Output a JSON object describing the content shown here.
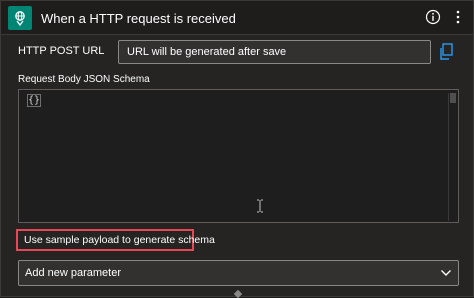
{
  "header": {
    "title": "When a HTTP request is received",
    "icon": "http-request-icon",
    "accent": "#008575"
  },
  "url": {
    "label": "HTTP POST URL",
    "value": "URL will be generated after save"
  },
  "schema": {
    "label": "Request Body JSON Schema",
    "content": "{}"
  },
  "actions": {
    "sample_payload": "Use sample payload to generate schema",
    "add_parameter": "Add new parameter"
  },
  "colors": {
    "highlight": "#e74856",
    "link_blue": "#2899f5"
  }
}
